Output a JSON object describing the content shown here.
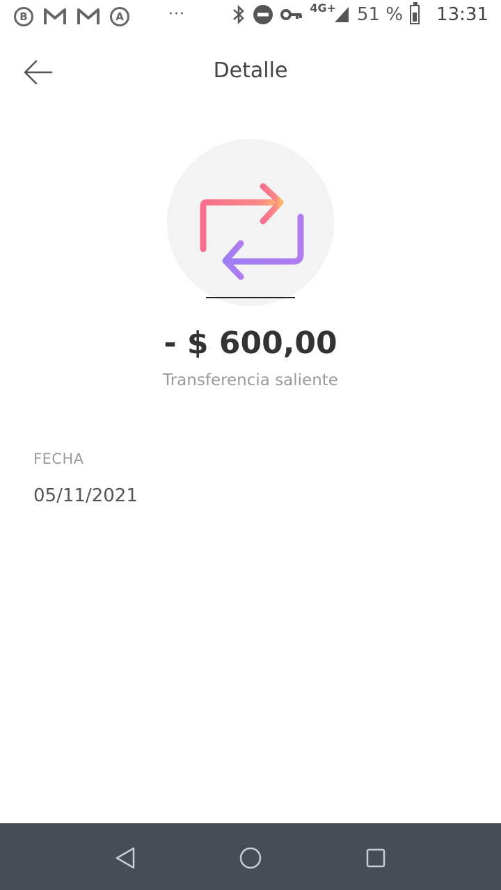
{
  "status_bar": {
    "left_icons": [
      "B",
      "M",
      "M",
      "A"
    ],
    "dots": "···",
    "network": "4G+",
    "battery": "51 %",
    "time": "13:31"
  },
  "header": {
    "title": "Detalle"
  },
  "transaction": {
    "amount": "- $ 600,00",
    "type": "Transferencia saliente",
    "icon": "transfer-arrows-icon",
    "colors": {
      "arrow_top": "#f87a8c",
      "arrow_bottom": "#a77ff0",
      "circle_bg": "#f3f3f4"
    }
  },
  "details": {
    "date_label": "FECHA",
    "date_value": "05/11/2021"
  },
  "nav_bar": {
    "icons": [
      "back-triangle-icon",
      "home-circle-icon",
      "recents-square-icon"
    ]
  }
}
